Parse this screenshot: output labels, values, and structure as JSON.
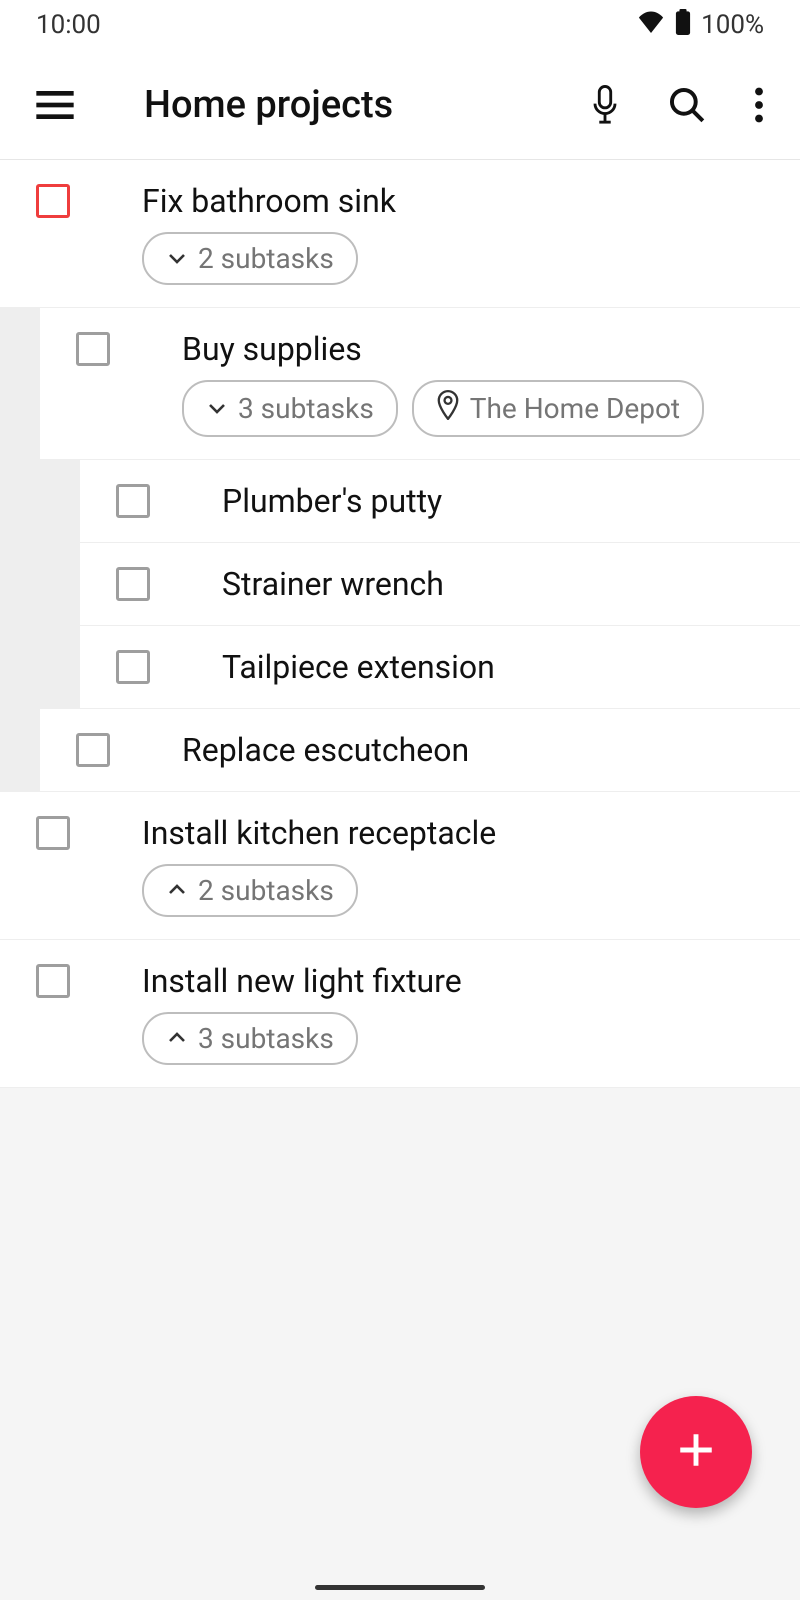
{
  "status_bar": {
    "time": "10:00",
    "battery": "100%"
  },
  "header": {
    "title": "Home projects"
  },
  "tasks": [
    {
      "title": "Fix bathroom sink",
      "priority": "red",
      "level": 0,
      "subtasks_chip": {
        "label": "2 subtasks",
        "direction": "down"
      }
    },
    {
      "title": "Buy supplies",
      "level": 1,
      "subtasks_chip": {
        "label": "3 subtasks",
        "direction": "down"
      },
      "location_chip": {
        "label": "The Home Depot"
      }
    },
    {
      "title": "Plumber's putty",
      "level": 2
    },
    {
      "title": "Strainer wrench",
      "level": 2
    },
    {
      "title": "Tailpiece extension",
      "level": 2
    },
    {
      "title": "Replace escutcheon",
      "level": 1
    },
    {
      "title": "Install kitchen receptacle",
      "level": 0,
      "subtasks_chip": {
        "label": "2 subtasks",
        "direction": "up"
      }
    },
    {
      "title": "Install new light fixture",
      "level": 0,
      "subtasks_chip": {
        "label": "3 subtasks",
        "direction": "up"
      }
    }
  ]
}
